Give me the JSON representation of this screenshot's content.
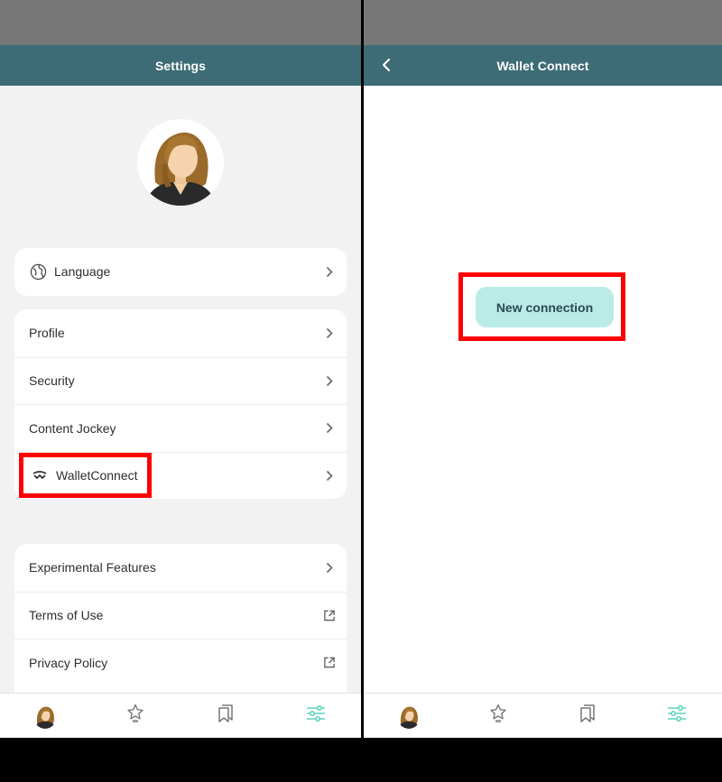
{
  "left": {
    "header": {
      "title": "Settings"
    },
    "card_language": {
      "items": [
        {
          "label": "Language",
          "icon": "globe-icon",
          "trail": "chevron-right-icon"
        }
      ]
    },
    "card_account": {
      "items": [
        {
          "label": "Profile",
          "trail": "chevron-right-icon"
        },
        {
          "label": "Security",
          "trail": "chevron-right-icon"
        },
        {
          "label": "Content Jockey",
          "trail": "chevron-right-icon"
        },
        {
          "label": "WalletConnect",
          "icon": "walletconnect-icon",
          "trail": "chevron-right-icon"
        }
      ]
    },
    "card_misc": {
      "items": [
        {
          "label": "Experimental Features",
          "trail": "chevron-right-icon"
        },
        {
          "label": "Terms of Use",
          "trail": "external-link-icon"
        },
        {
          "label": "Privacy Policy",
          "trail": "external-link-icon"
        }
      ]
    }
  },
  "right": {
    "header": {
      "title": "Wallet Connect"
    },
    "new_connection_label": "New connection"
  },
  "bottom_nav": {
    "items": [
      {
        "icon": "avatar-icon"
      },
      {
        "icon": "star-icon"
      },
      {
        "icon": "bookmarks-icon"
      },
      {
        "icon": "settings-sliders-icon",
        "active": true
      }
    ]
  },
  "colors": {
    "header_bg": "#3d6b76",
    "status_bar": "#787878",
    "accent": "#5fd3bd",
    "button_bg": "#b9ece6",
    "highlight": "#ff0000"
  }
}
